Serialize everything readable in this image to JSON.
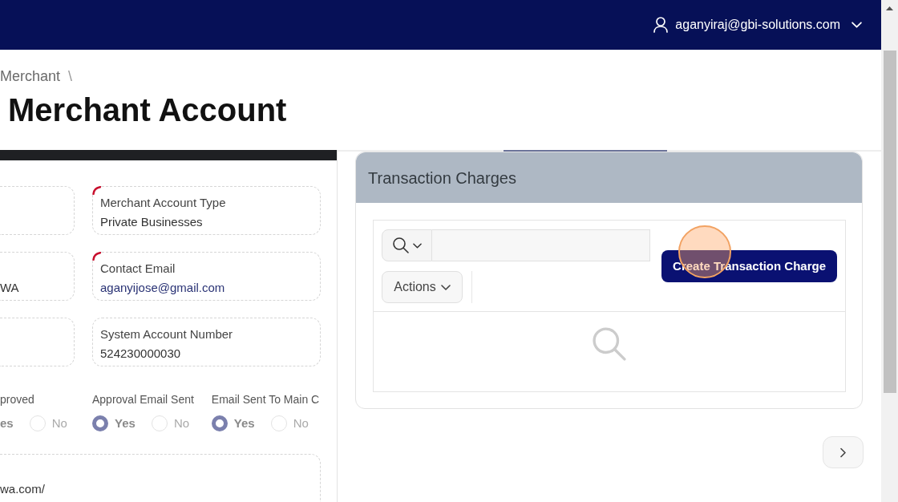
{
  "header": {
    "user_email": "aganyiraj@gbi-solutions.com"
  },
  "breadcrumb": {
    "items": [
      "Merchant"
    ],
    "separator": "\\"
  },
  "page_title": "Merchant Account",
  "field_rows": [
    {
      "left": {
        "required": false
      },
      "right": {
        "label": "Merchant Account Type",
        "value": "Private Businesses",
        "kind": "text",
        "required": true
      }
    },
    {
      "left": {
        "value": "WA",
        "kind": "text",
        "required": false
      },
      "right": {
        "label": "Contact Email",
        "value": "aganyijose@gmail.com",
        "kind": "email",
        "required": true
      }
    },
    {
      "left": {
        "required": false
      },
      "right": {
        "label": "System Account Number",
        "value": "524230000030",
        "kind": "text",
        "required": false
      }
    }
  ],
  "radio_groups": [
    {
      "label": "proved",
      "options": [
        {
          "label": "es",
          "selected": true
        },
        {
          "label": "No",
          "selected": false
        }
      ]
    },
    {
      "label": "Approval Email Sent",
      "options": [
        {
          "label": "Yes",
          "selected": true
        },
        {
          "label": "No",
          "selected": false
        }
      ]
    },
    {
      "label": "Email Sent To Main C",
      "options": [
        {
          "label": "Yes",
          "selected": true
        },
        {
          "label": "No",
          "selected": false
        }
      ]
    }
  ],
  "url_field": {
    "value": "wa.com/"
  },
  "transaction_charges": {
    "title": "Transaction Charges",
    "actions_button": "Actions",
    "create_button": "Create Transaction Charge"
  }
}
